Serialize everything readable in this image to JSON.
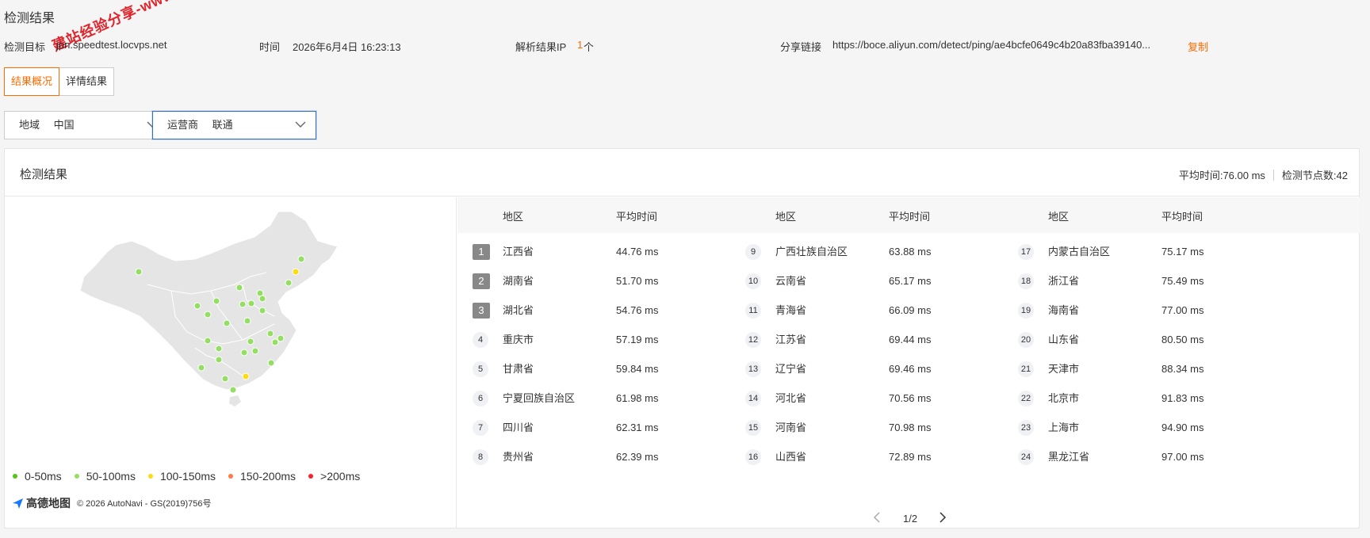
{
  "page": {
    "title": "检测结果"
  },
  "meta": {
    "target_label": "检测目标",
    "target_value": "jpn.speedtest.locvps.net",
    "time_label": "时间",
    "time_value": "2026年6月4日 16:23:13",
    "ip_label": "解析结果IP",
    "ip_count": "1",
    "ip_unit": "个",
    "share_label": "分享链接",
    "share_url": "https://boce.aliyun.com/detect/ping/ae4bcfe0649c4b20a83fba39140...",
    "copy_label": "复制"
  },
  "watermark": "建站经验分享-www.ia",
  "tabs": [
    {
      "label": "结果概况"
    },
    {
      "label": "详情结果"
    }
  ],
  "filters": {
    "region": {
      "label": "地域",
      "value": "中国"
    },
    "isp": {
      "label": "运营商",
      "value": "联通"
    }
  },
  "panel": {
    "title": "检测结果",
    "avg_time": "平均时间:76.00 ms",
    "node_count": "检测节点数:42"
  },
  "legend": [
    {
      "label": "0-50ms",
      "color": "#52c41a"
    },
    {
      "label": "50-100ms",
      "color": "#95de64"
    },
    {
      "label": "100-150ms",
      "color": "#fadb14"
    },
    {
      "label": "150-200ms",
      "color": "#ff7a45"
    },
    {
      "label": ">200ms",
      "color": "#f5222d"
    }
  ],
  "map_credit": {
    "logo": "高德地图",
    "text": "© 2026 AutoNavi - GS(2019)756号"
  },
  "table": {
    "headers": {
      "region": "地区",
      "avg": "平均时间"
    },
    "columns": [
      [
        {
          "rank": "1",
          "region": "江西省",
          "avg": "44.76 ms"
        },
        {
          "rank": "2",
          "region": "湖南省",
          "avg": "51.70 ms"
        },
        {
          "rank": "3",
          "region": "湖北省",
          "avg": "54.76 ms"
        },
        {
          "rank": "4",
          "region": "重庆市",
          "avg": "57.19 ms"
        },
        {
          "rank": "5",
          "region": "甘肃省",
          "avg": "59.84 ms"
        },
        {
          "rank": "6",
          "region": "宁夏回族自治区",
          "avg": "61.98 ms"
        },
        {
          "rank": "7",
          "region": "四川省",
          "avg": "62.31 ms"
        },
        {
          "rank": "8",
          "region": "贵州省",
          "avg": "62.39 ms"
        }
      ],
      [
        {
          "rank": "9",
          "region": "广西壮族自治区",
          "avg": "63.88 ms"
        },
        {
          "rank": "10",
          "region": "云南省",
          "avg": "65.17 ms"
        },
        {
          "rank": "11",
          "region": "青海省",
          "avg": "66.09 ms"
        },
        {
          "rank": "12",
          "region": "江苏省",
          "avg": "69.44 ms"
        },
        {
          "rank": "13",
          "region": "辽宁省",
          "avg": "69.46 ms"
        },
        {
          "rank": "14",
          "region": "河北省",
          "avg": "70.56 ms"
        },
        {
          "rank": "15",
          "region": "河南省",
          "avg": "70.98 ms"
        },
        {
          "rank": "16",
          "region": "山西省",
          "avg": "72.89 ms"
        }
      ],
      [
        {
          "rank": "17",
          "region": "内蒙古自治区",
          "avg": "75.17 ms"
        },
        {
          "rank": "18",
          "region": "浙江省",
          "avg": "75.49 ms"
        },
        {
          "rank": "19",
          "region": "海南省",
          "avg": "77.00 ms"
        },
        {
          "rank": "20",
          "region": "山东省",
          "avg": "80.50 ms"
        },
        {
          "rank": "21",
          "region": "天津市",
          "avg": "88.34 ms"
        },
        {
          "rank": "22",
          "region": "北京市",
          "avg": "91.83 ms"
        },
        {
          "rank": "23",
          "region": "上海市",
          "avg": "94.90 ms"
        },
        {
          "rank": "24",
          "region": "黑龙江省",
          "avg": "97.00 ms"
        }
      ]
    ]
  },
  "pagination": {
    "current": "1/2"
  }
}
